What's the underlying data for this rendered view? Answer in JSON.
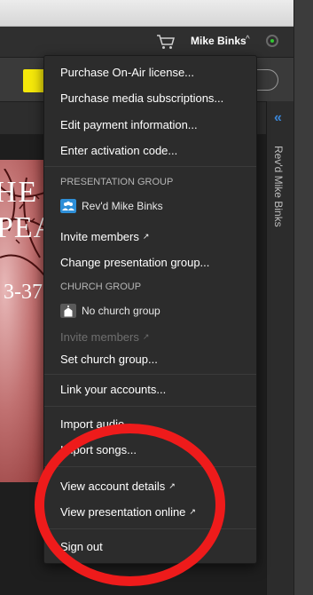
{
  "header": {
    "user_name": "Mike Binks",
    "chevron": "^",
    "cart_icon": "cart-icon",
    "status_color": "#31c831"
  },
  "side_panel": {
    "collapse_glyph": "«",
    "label": "Rev'd Mike Binks"
  },
  "poster": {
    "line1": "HE",
    "line2": "PEA",
    "line3": "3-37"
  },
  "menu": {
    "purchase_license": "Purchase On-Air license...",
    "purchase_media": "Purchase media subscriptions...",
    "edit_payment": "Edit payment information...",
    "enter_activation": "Enter activation code...",
    "presentation_group_header": "PRESENTATION GROUP",
    "presentation_group_name": "Rev'd Mike Binks",
    "invite_members": "Invite members",
    "change_presentation_group": "Change presentation group...",
    "church_group_header": "CHURCH GROUP",
    "church_group_name": "No church group",
    "invite_members_disabled": "Invite members",
    "set_church_group": "Set church group...",
    "link_accounts": "Link your accounts...",
    "import_audio": "Import audio...",
    "import_songs": "Import songs...",
    "view_account_details": "View account details",
    "view_presentation_online": "View presentation online",
    "sign_out": "Sign out",
    "external_link_glyph": "↗"
  },
  "colors": {
    "accent_blue": "#3a86d8",
    "yellow": "#f5e80a",
    "highlight_circle": "#ee1b1b"
  }
}
